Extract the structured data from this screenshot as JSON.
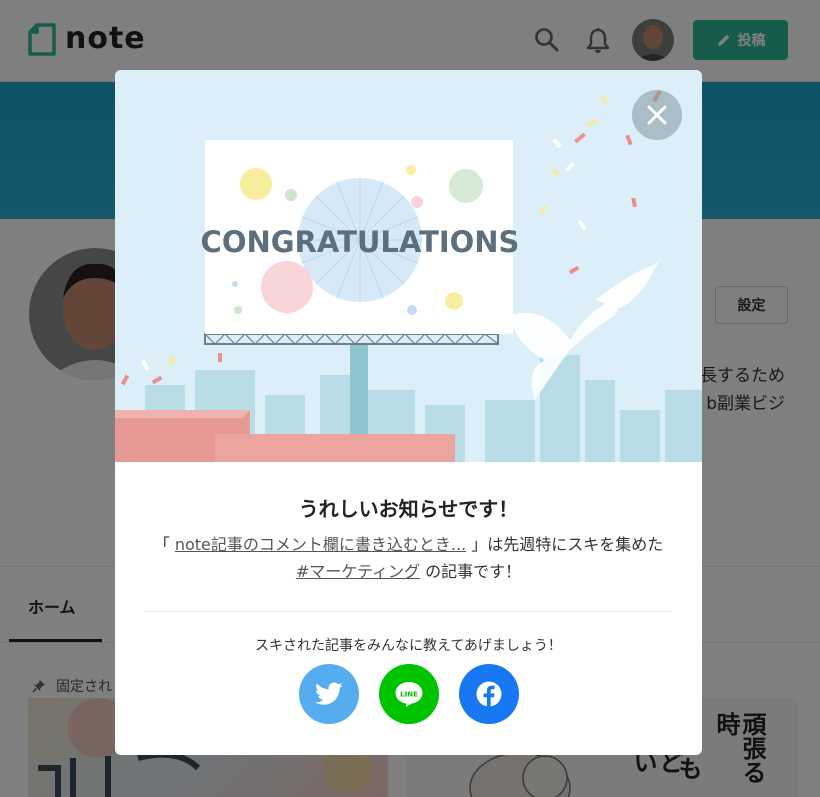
{
  "header": {
    "logo_text": "note",
    "icons": [
      "search-icon",
      "bell-icon",
      "user-avatar"
    ],
    "post_label": "投稿",
    "accent": "#2cb696"
  },
  "profile": {
    "settings_label": "設定",
    "bio_line1": "長するため",
    "bio_line2": "b副業ビジ"
  },
  "tabs": {
    "home": "ホーム"
  },
  "pinned": {
    "label": "固定され"
  },
  "cards": {
    "card2_col1": "頑張る時",
    "card2_col2": "も",
    "card2_col3": "どい"
  },
  "modal": {
    "illustration_text": "CONGRATULATIONS",
    "title": "うれしいお知らせです！",
    "body_open": "「 ",
    "article_link": "note記事のコメント欄に書き込むとき...",
    "body_mid": " 」は先週特にスキを集めた ",
    "tag_link": "#マーケティング",
    "body_end": " の記事です！",
    "share_prompt": "スキされた記事をみんなに教えてあげましょう！",
    "share_buttons": {
      "twitter": "twitter-icon",
      "line_label": "LINE",
      "facebook": "facebook-icon"
    },
    "colors": {
      "twitter": "#55acee",
      "line": "#00c300",
      "facebook": "#1877f2"
    }
  }
}
